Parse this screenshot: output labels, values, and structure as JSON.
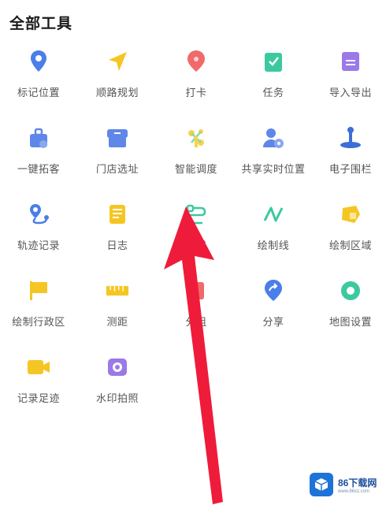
{
  "header": {
    "title": "全部工具"
  },
  "tools": [
    {
      "label": "标记位置",
      "icon": "location-pin-icon",
      "color": "#4a7ee8"
    },
    {
      "label": "顺路规划",
      "icon": "paper-plane-icon",
      "color": "#f5c623"
    },
    {
      "label": "打卡",
      "icon": "check-in-pin-icon",
      "color": "#f06a6a"
    },
    {
      "label": "任务",
      "icon": "task-clipboard-icon",
      "color": "#3cc9a0"
    },
    {
      "label": "导入导出",
      "icon": "import-export-file-icon",
      "color": "#9b79e8"
    },
    {
      "label": "一键拓客",
      "icon": "briefcase-icon",
      "color": "#5f86e9"
    },
    {
      "label": "门店选址",
      "icon": "store-icon",
      "color": "#5f86e9"
    },
    {
      "label": "智能调度",
      "icon": "dispatch-icon",
      "color": "#f5d44a"
    },
    {
      "label": "共享实时位置",
      "icon": "share-location-user-icon",
      "color": "#5f86e9"
    },
    {
      "label": "电子围栏",
      "icon": "geofence-icon",
      "color": "#3b6fd8"
    },
    {
      "label": "轨迹记录",
      "icon": "track-record-icon",
      "color": "#4a7ee8"
    },
    {
      "label": "日志",
      "icon": "log-book-icon",
      "color": "#f5c623"
    },
    {
      "label": "画线",
      "icon": "route-line-icon",
      "color": "#3cc9a0"
    },
    {
      "label": "绘制线",
      "icon": "draw-line-icon",
      "color": "#3cc9a0"
    },
    {
      "label": "绘制区域",
      "icon": "draw-area-icon",
      "color": "#f5c623"
    },
    {
      "label": "绘制行政区",
      "icon": "flag-icon",
      "color": "#f5c623"
    },
    {
      "label": "测距",
      "icon": "ruler-icon",
      "color": "#f5c623"
    },
    {
      "label": "分组",
      "icon": "group-icon",
      "color": "#f06a6a"
    },
    {
      "label": "分享",
      "icon": "share-pin-icon",
      "color": "#4a7ee8"
    },
    {
      "label": "地图设置",
      "icon": "map-settings-icon",
      "color": "#3cc9a0"
    },
    {
      "label": "记录足迹",
      "icon": "video-record-icon",
      "color": "#f5c623"
    },
    {
      "label": "水印拍照",
      "icon": "watermark-camera-icon",
      "color": "#9b79e8"
    }
  ],
  "annotation": {
    "arrow_color": "#ee1c3a"
  },
  "watermark": {
    "brand": "86下载网",
    "url": "www.86xz.com",
    "color": "#1d73d8"
  }
}
